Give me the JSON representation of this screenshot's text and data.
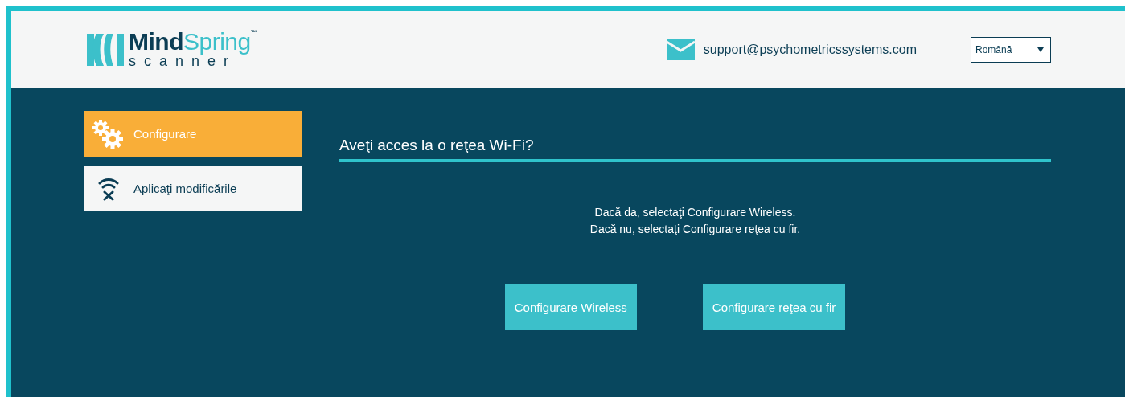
{
  "header": {
    "logo": {
      "name_first": "Mind",
      "name_second": "Spring",
      "trademark": "™",
      "subtitle": "scanner"
    },
    "email": "support@psychometricssystems.com",
    "language": "Română"
  },
  "sidebar": {
    "items": [
      {
        "label": "Configurare",
        "kind": "gears",
        "selected": true
      },
      {
        "label": "Aplicaţi modificările",
        "kind": "wifi",
        "selected": false
      }
    ]
  },
  "main": {
    "title": "Aveţi acces la o reţea Wi-Fi?",
    "lines": [
      "Dacă da, selectaţi Configurare Wireless.",
      "Dacă nu, selectaţi Configurare reţea cu fir."
    ],
    "buttons": [
      "Configurare Wireless",
      "Configurare reţea cu fir"
    ]
  }
}
